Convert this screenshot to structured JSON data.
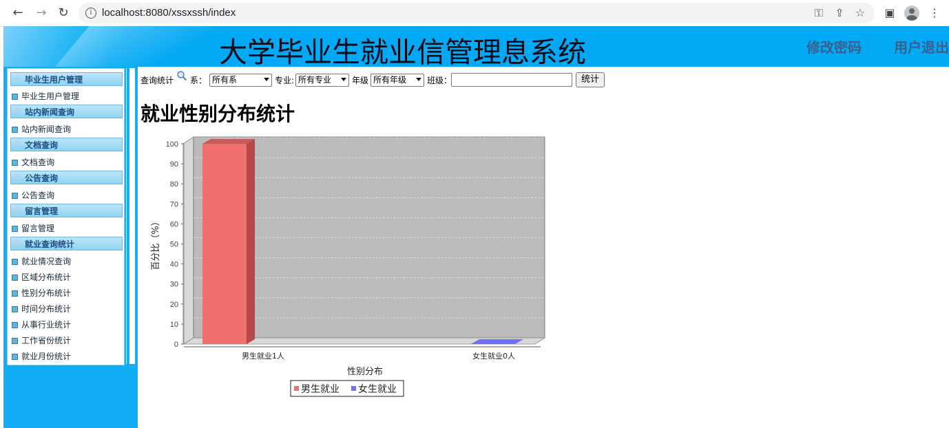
{
  "browser": {
    "url": "localhost:8080/xssxssh/index",
    "back_icon": "back-arrow-icon",
    "forward_icon": "forward-arrow-icon",
    "reload_icon": "reload-icon"
  },
  "header": {
    "title": "大学毕业生就业信管理息系统",
    "change_password": "修改密码",
    "logout": "用户退出"
  },
  "sidebar": {
    "groups": [
      {
        "label": "毕业生用户管理",
        "items": [
          {
            "label": "毕业生用户管理"
          }
        ]
      },
      {
        "label": "站内新闻查询",
        "items": [
          {
            "label": "站内新闻查询"
          }
        ]
      },
      {
        "label": "文档查询",
        "items": [
          {
            "label": "文档查询"
          }
        ]
      },
      {
        "label": "公告查询",
        "items": [
          {
            "label": "公告查询"
          }
        ]
      },
      {
        "label": "留言管理",
        "items": [
          {
            "label": "留言管理"
          }
        ]
      },
      {
        "label": "就业查询统计",
        "items": [
          {
            "label": "就业情况查询"
          },
          {
            "label": "区域分布统计"
          },
          {
            "label": "性别分布统计"
          },
          {
            "label": "时间分布统计"
          },
          {
            "label": "从事行业统计"
          },
          {
            "label": "工作省份统计"
          },
          {
            "label": "就业月份统计"
          }
        ]
      }
    ]
  },
  "filters": {
    "query_label": "查询统计",
    "dept_label": "系：",
    "dept_value": "所有系",
    "major_label": "专业:",
    "major_value": "所有专业",
    "grade_label": "年级",
    "grade_value": "所有年级",
    "class_label": "班级：",
    "class_value": "",
    "submit_label": "统计"
  },
  "page_title": "就业性别分布统计",
  "chart_data": {
    "type": "bar",
    "categories": [
      "男生就业1人",
      "女生就业0人"
    ],
    "values": [
      100,
      0
    ],
    "series": [
      {
        "name": "男生就业",
        "values": [
          100,
          0
        ],
        "color": "#f07070"
      },
      {
        "name": "女生就业",
        "values": [
          0,
          0
        ],
        "color": "#7070ff"
      }
    ],
    "xlabel": "性别分布",
    "ylabel": "百分比（%）",
    "ylim": [
      0,
      100
    ],
    "yticks": [
      0,
      10,
      20,
      30,
      40,
      50,
      60,
      70,
      80,
      90,
      100
    ],
    "grid": true,
    "legend": "bottom",
    "plot_background": "#bbbbbb"
  }
}
